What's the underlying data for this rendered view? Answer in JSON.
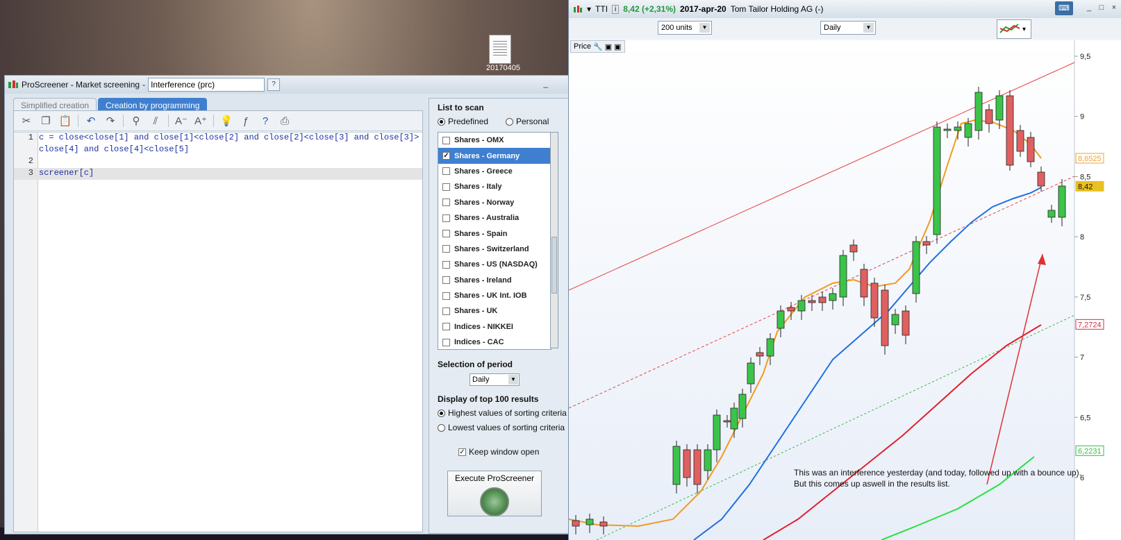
{
  "desktop": {
    "icon_label": "20170405"
  },
  "proscreener": {
    "title": "ProScreener - Market screening",
    "title_sep": "-",
    "name_value": "Interference (prc)",
    "help_icon": "?",
    "minimize": "_",
    "tabs": [
      {
        "label": "Simplified creation"
      },
      {
        "label": "Creation by programming"
      }
    ],
    "code_lines": [
      {
        "num": "1",
        "text": "c = close<close[1] and close[1]<close[2] and close[2]<close[3] and close[3]>"
      },
      {
        "num": "",
        "text": "close[4] and close[4]<close[5]"
      },
      {
        "num": "2",
        "text": ""
      },
      {
        "num": "3",
        "text": "screener[c]"
      }
    ],
    "list_to_scan": "List to scan",
    "predefined": "Predefined",
    "personal": "Personal",
    "list_items": [
      {
        "label": "Shares - OMX",
        "checked": false
      },
      {
        "label": "Shares - Germany",
        "checked": true
      },
      {
        "label": "Shares - Greece",
        "checked": false
      },
      {
        "label": "Shares - Italy",
        "checked": false
      },
      {
        "label": "Shares - Norway",
        "checked": false
      },
      {
        "label": "Shares - Australia",
        "checked": false
      },
      {
        "label": "Shares - Spain",
        "checked": false
      },
      {
        "label": "Shares - Switzerland",
        "checked": false
      },
      {
        "label": "Shares - US (NASDAQ)",
        "checked": false
      },
      {
        "label": "Shares - Ireland",
        "checked": false
      },
      {
        "label": "Shares - UK Int. IOB",
        "checked": false
      },
      {
        "label": "Shares - UK",
        "checked": false
      },
      {
        "label": "Indices - NIKKEI",
        "checked": false
      },
      {
        "label": "Indices - CAC",
        "checked": false
      }
    ],
    "checkmark": "✓",
    "selection_of_period": "Selection of period",
    "period_value": "Daily",
    "display_top": "Display of top 100 results",
    "highest": "Highest values of sorting criteria",
    "lowest": "Lowest values of sorting criteria",
    "keep_open": "Keep window open",
    "execute": "Execute ProScreener"
  },
  "chart": {
    "menu_arrow": "▾",
    "ticker": "TTI",
    "info_icon": "i",
    "price_change": "8,42 (+2,31%)",
    "date": "2017-apr-20",
    "company": "Tom Tailor Holding AG (-)",
    "units": "200 units",
    "timeframe": "Daily",
    "price_label": "Price",
    "window_buttons": [
      "_",
      "□",
      "×"
    ],
    "price_axis": [
      "9,5",
      "9",
      "8,5",
      "8",
      "7,5",
      "7",
      "6,5",
      "6"
    ],
    "tags": [
      {
        "value": "8,6525",
        "color": "#f0a030"
      },
      {
        "value": "8,42",
        "color": "#e8c020"
      },
      {
        "value": "7,2724",
        "color": "#d03040"
      },
      {
        "value": "6,2231",
        "color": "#30c040"
      }
    ],
    "annotation_line1": "This was an interference yesterday (and today, followed up with a bounce up).",
    "annotation_line2": "But this comes up aswell in the results list.",
    "colors": {
      "up": "#3cc44a",
      "down": "#e06060",
      "ma_fast": "#f29a20",
      "ma_mid": "#1e6fe0",
      "ma_slow": "#e0202c",
      "ma_long": "#28e040",
      "trend": "#e83a3a",
      "trend_dash": "#e04848",
      "green_dash": "#40b050"
    }
  }
}
